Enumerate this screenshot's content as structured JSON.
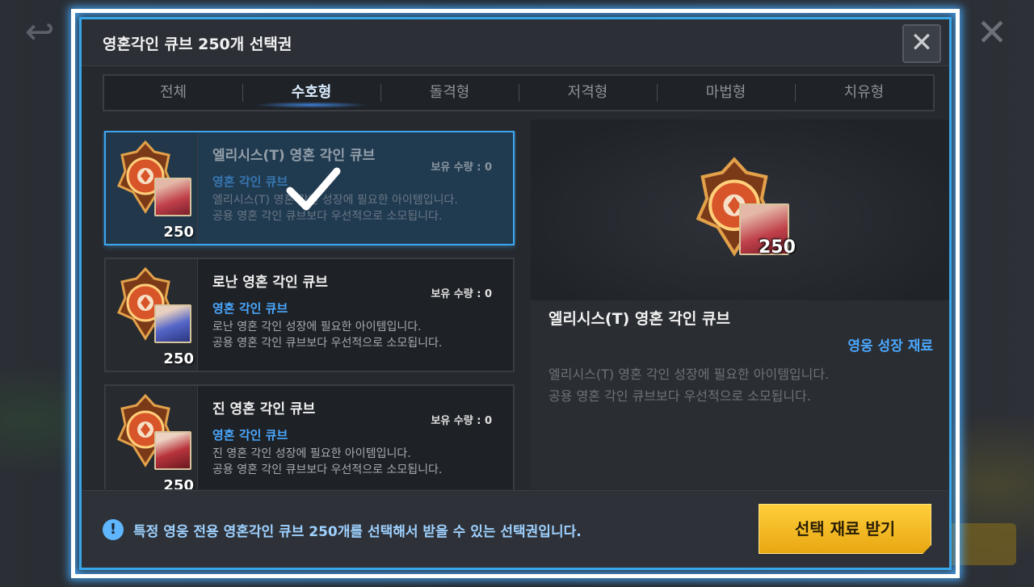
{
  "dialog": {
    "title": "영혼각인 큐브 250개 선택권",
    "close_icon": "close-icon"
  },
  "tabs": [
    {
      "label": "전체",
      "active": false
    },
    {
      "label": "수호형",
      "active": true
    },
    {
      "label": "돌격형",
      "active": false
    },
    {
      "label": "저격형",
      "active": false
    },
    {
      "label": "마법형",
      "active": false
    },
    {
      "label": "치유형",
      "active": false
    }
  ],
  "items": [
    {
      "name": "엘리시스(T) 영혼 각인 큐브",
      "owned": "보유 수량 : 0",
      "category": "영혼 각인 큐브",
      "desc1": "엘리시스(T) 영혼 각인 성장에 필요한 아이템입니다.",
      "desc2": "공용 영혼 각인 큐브보다 우선적으로 소모됩니다.",
      "count": "250",
      "selected": true,
      "portrait_color": "#c0404a"
    },
    {
      "name": "로난 영혼 각인 큐브",
      "owned": "보유 수량 : 0",
      "category": "영혼 각인 큐브",
      "desc1": "로난 영혼 각인 성장에 필요한 아이템입니다.",
      "desc2": "공용 영혼 각인 큐브보다 우선적으로 소모됩니다.",
      "count": "250",
      "selected": false,
      "portrait_color": "#5566c8"
    },
    {
      "name": "진 영혼 각인 큐브",
      "owned": "보유 수량 : 0",
      "category": "영혼 각인 큐브",
      "desc1": "진 영혼 각인 성장에 필요한 아이템입니다.",
      "desc2": "공용 영혼 각인 큐브보다 우선적으로 소모됩니다.",
      "count": "250",
      "selected": false,
      "portrait_color": "#b8343c"
    }
  ],
  "detail": {
    "name": "엘리시스(T)  영혼 각인 큐브",
    "category": "영웅 성장 재료",
    "desc1": "엘리시스(T) 영혼 각인 성장에 필요한 아이템입니다.",
    "desc2": "공용 영혼 각인 큐브보다 우선적으로 소모됩니다.",
    "count": "250"
  },
  "footer": {
    "info_icon": "exclamation-icon",
    "notice": "특정 영웅 전용 영혼각인 큐브 250개를 선택해서 받을 수 있는 선택권입니다.",
    "claim_label": "선택 재료 받기"
  },
  "colors": {
    "accent_blue": "#38a6e8",
    "category_blue": "#4aa8ff",
    "button_gold": "#ffcf3a"
  }
}
